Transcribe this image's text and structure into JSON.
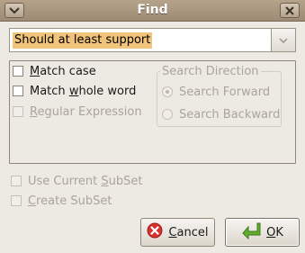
{
  "window": {
    "title": "Find"
  },
  "search": {
    "value": "Should at least support"
  },
  "options": {
    "match_case": {
      "pre": "",
      "key": "M",
      "post": "atch case"
    },
    "match_whole_word": {
      "pre": "Match ",
      "key": "w",
      "post": "hole word"
    },
    "regular_expression": {
      "pre": "",
      "key": "R",
      "post": "egular Expression"
    }
  },
  "direction": {
    "title": "Search Direction",
    "forward": "Search Forward",
    "backward": "Search Backward"
  },
  "subset": {
    "use_current": {
      "pre": "Use Current ",
      "key": "S",
      "post": "ubSet"
    },
    "create": {
      "pre": "",
      "key": "C",
      "post": "reate SubSet"
    }
  },
  "buttons": {
    "cancel": {
      "key": "C",
      "post": "ancel"
    },
    "ok": {
      "key": "O",
      "post": "K"
    }
  },
  "icons": {
    "close": "close-icon",
    "dropdown": "chevron-down-icon",
    "cancel": "cancel-icon",
    "ok": "ok-arrow-icon"
  },
  "colors": {
    "selection": "#f2c37a",
    "titlebar": "#a8967f",
    "cancel_icon": "#d8322e",
    "ok_icon": "#5fae2e"
  }
}
